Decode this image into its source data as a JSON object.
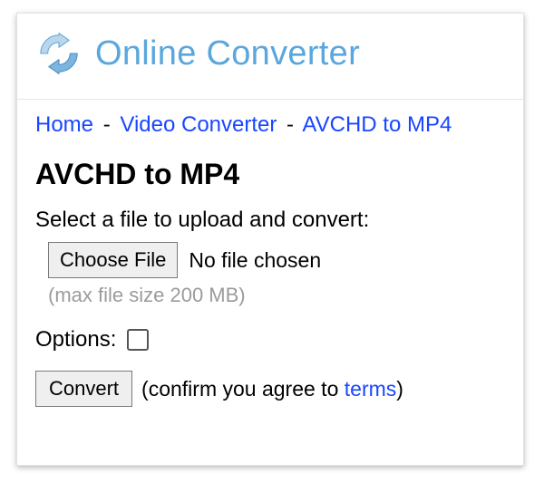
{
  "header": {
    "site_name": "Online Converter"
  },
  "breadcrumb": {
    "home": "Home",
    "video_converter": "Video Converter",
    "current": "AVCHD to MP4",
    "sep": "-"
  },
  "page": {
    "title": "AVCHD to MP4"
  },
  "form": {
    "prompt": "Select a file to upload and convert:",
    "choose_label": "Choose File",
    "no_file": "No file chosen",
    "limit": "(max file size 200 MB)",
    "options_label": "Options:",
    "options_checked": false,
    "convert_label": "Convert",
    "agree_prefix": "(confirm you agree to ",
    "terms_label": "terms",
    "agree_suffix": ")"
  },
  "icons": {
    "logo": "refresh-arrows-icon"
  },
  "colors": {
    "brand": "#5aa7dd",
    "link": "#1946ff",
    "muted": "#9b9b9b"
  }
}
